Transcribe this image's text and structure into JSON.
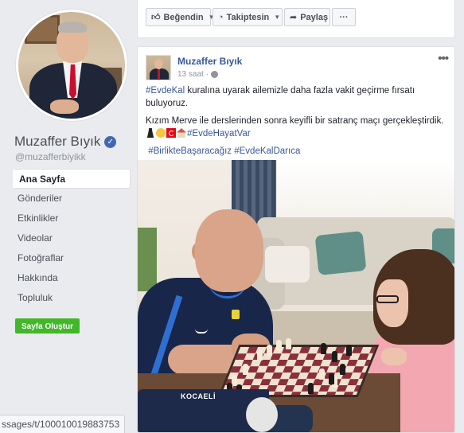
{
  "profile": {
    "name": "Muzaffer Bıyık",
    "handle": "@muzafferbiyikk",
    "verified_icon": "checkmark-icon"
  },
  "nav": {
    "items": [
      {
        "label": "Ana Sayfa",
        "active": true
      },
      {
        "label": "Gönderiler",
        "active": false
      },
      {
        "label": "Etkinlikler",
        "active": false
      },
      {
        "label": "Videolar",
        "active": false
      },
      {
        "label": "Fotoğraflar",
        "active": false
      },
      {
        "label": "Hakkında",
        "active": false
      },
      {
        "label": "Topluluk",
        "active": false
      }
    ],
    "create_page_label": "Sayfa Oluştur"
  },
  "actions": {
    "like_label": "Beğendin",
    "follow_label": "Takiptesin",
    "share_label": "Paylaş",
    "more_label": "···"
  },
  "post": {
    "author": "Muzaffer Bıyık",
    "time": "13 saat ·",
    "options_label": "•••",
    "p1_hashtag": "#EvdeKal",
    "p1_text": " kuralına uyarak ailemizle daha fazla vakit geçirme fırsatı buluyoruz.",
    "p2_text": "Kızım Merve ile derslerinden sonra keyifli bir satranç maçı gerçekleştirdik.",
    "p2_hashtag": "#EvdeHayatVar",
    "p3_hashtag1": "#BirlikteBaşaracağız",
    "p3_hashtag2": "#EvdeKalDarıca",
    "photo_text": "KOCAELİ"
  },
  "status_url": "ssages/t/100010019883753",
  "colors": {
    "link": "#385898",
    "green_button": "#42b72a",
    "verified": "#4267b2"
  }
}
